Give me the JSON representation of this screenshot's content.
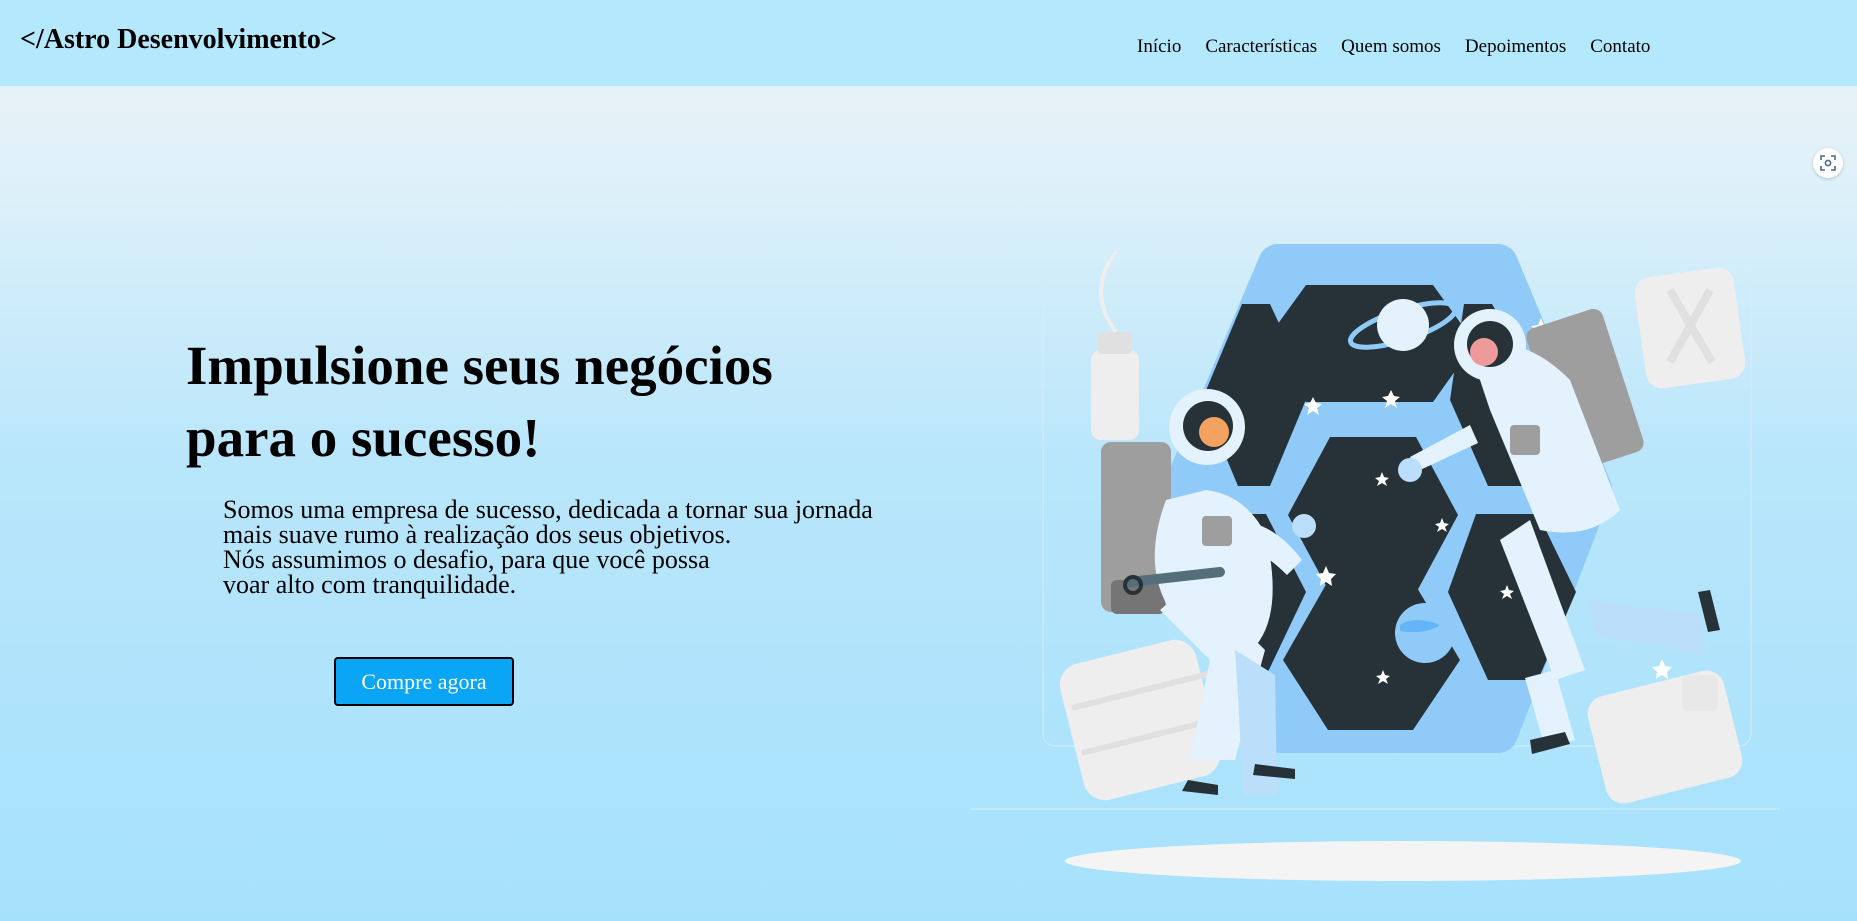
{
  "header": {
    "logo": "</Astro Desenvolvimento>",
    "nav": [
      "Início",
      "Características",
      "Quem somos",
      "Depoimentos",
      "Contato"
    ]
  },
  "hero": {
    "title_lines": [
      "Impulsione seus negócios",
      "para o sucesso!"
    ],
    "description_lines": [
      "Somos uma empresa de sucesso, dedicada a tornar sua jornada",
      "mais suave rumo à realização dos seus objetivos.",
      "Nós assumimos o desafio, para que você possa",
      "voar alto com tranquilidade."
    ],
    "cta_label": "Compre agora"
  },
  "icons": {
    "scan": "scan-icon",
    "illustration": "astronauts-hexagon-illustration"
  },
  "colors": {
    "header_bg": "#b3e8fd",
    "cta_bg": "#0aa6f5",
    "hex_frame": "#90caf9",
    "hex_dark": "#263238"
  }
}
